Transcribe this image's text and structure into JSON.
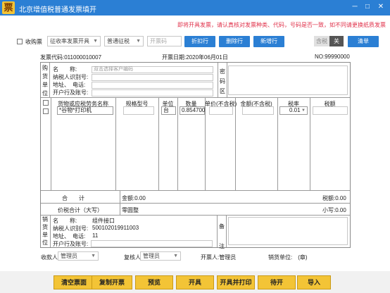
{
  "app": {
    "title": "北京增值税普通发票填开",
    "icon_glyph": "票"
  },
  "window_controls": {
    "minimize": "─",
    "maximize": "□",
    "close": "✕"
  },
  "notice": "即将开具发票，请认真核对发票种类、代码，号码是否一致，如不同请更换纸质发票",
  "toolbar": {
    "buyer_label": "收购票",
    "type_select": "征收率发票开具",
    "tax_select": "普通征税",
    "code_placeholder": "开票码",
    "discount_btn": "折扣行",
    "delete_btn": "删除行",
    "add_btn": "新增行",
    "tax_incl": "含税",
    "tax_off": "关",
    "clear_btn": "清单"
  },
  "invoice": {
    "code_label": "发票代码:",
    "code": "011000010007",
    "date_label": "开票日期:",
    "date": "2020年06月01日",
    "no_label": "NO:",
    "no": "99990000"
  },
  "buyer": {
    "side_label": [
      "购",
      "货",
      "单",
      "位"
    ],
    "name_label": "名　　称:",
    "name_placeholder": "双击选择客户编码",
    "tax_id_label": "纳税人识别号:",
    "addr_label": "地址、　电话:",
    "bank_label": "开户行及账号:",
    "secret_label": [
      "密",
      "码",
      "区"
    ]
  },
  "items": {
    "headers": [
      "货物或应税劳务名称",
      "规格型号",
      "单位",
      "数量",
      "单价(不含税)",
      "金额(不含税)",
      "税率",
      "税额"
    ],
    "row": {
      "name": "*谷物*打印机",
      "spec": "",
      "unit": "台",
      "qty": "0.854700",
      "price": "",
      "amount": "",
      "rate": "0.01",
      "tax": ""
    }
  },
  "totals": {
    "total_label": "合　　计",
    "amount": "金额:0.00",
    "tax": "税额:0.00",
    "sum_label": "价税合计（大写）",
    "sum_upper": "零圆整",
    "sum_lower": "小写:0.00"
  },
  "seller": {
    "side_label": [
      "销",
      "货",
      "单",
      "位"
    ],
    "name_label": "名　　称:",
    "name": "组件接口",
    "tax_id_label": "纳税人识别号:",
    "tax_id": "500102019911003",
    "addr_label": "地址、　电话:",
    "addr": "11",
    "bank_label": "开户行及账号:",
    "note_label": [
      "备",
      "注"
    ]
  },
  "signers": {
    "payee_label": "收款人:",
    "payee": "管理员",
    "reviewer_label": "复核人:",
    "reviewer": "管理员",
    "drawer": "开票人:管理员",
    "seller_unit": "销货单位:　(章)"
  },
  "actions": [
    "清空票面",
    "复制开票",
    "预览",
    "开具",
    "开具并打印",
    "待开",
    "导入"
  ],
  "colors": {
    "accent": "#2b7fd4",
    "action_yellow": "#f3c436",
    "notice_red": "#e0304a"
  }
}
